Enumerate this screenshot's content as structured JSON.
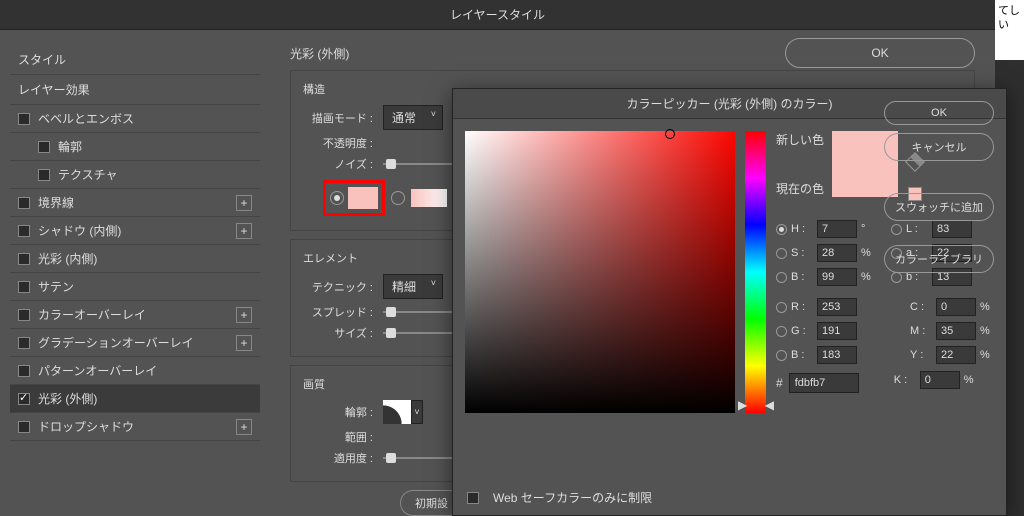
{
  "rightStrip": "てし\nい",
  "dialog": {
    "title": "レイヤースタイル",
    "okLabel": "OK",
    "sidebar": {
      "header1": "スタイル",
      "header2": "レイヤー効果",
      "items": [
        {
          "label": "ベベルとエンボス",
          "checked": false,
          "plus": false,
          "indent": false
        },
        {
          "label": "輪郭",
          "checked": false,
          "plus": false,
          "indent": true
        },
        {
          "label": "テクスチャ",
          "checked": false,
          "plus": false,
          "indent": true
        },
        {
          "label": "境界線",
          "checked": false,
          "plus": true,
          "indent": false
        },
        {
          "label": "シャドウ (内側)",
          "checked": false,
          "plus": true,
          "indent": false
        },
        {
          "label": "光彩 (内側)",
          "checked": false,
          "plus": false,
          "indent": false
        },
        {
          "label": "サテン",
          "checked": false,
          "plus": false,
          "indent": false
        },
        {
          "label": "カラーオーバーレイ",
          "checked": false,
          "plus": true,
          "indent": false
        },
        {
          "label": "グラデーションオーバーレイ",
          "checked": false,
          "plus": true,
          "indent": false
        },
        {
          "label": "パターンオーバーレイ",
          "checked": false,
          "plus": false,
          "indent": false
        },
        {
          "label": "光彩 (外側)",
          "checked": true,
          "plus": false,
          "indent": false,
          "active": true
        },
        {
          "label": "ドロップシャドウ",
          "checked": false,
          "plus": true,
          "indent": false
        }
      ]
    },
    "panel": {
      "title": "光彩 (外側)",
      "struct": {
        "title": "構造",
        "blendMode": {
          "label": "描画モード :",
          "value": "通常"
        },
        "opacity": {
          "label": "不透明度 :"
        },
        "noise": {
          "label": "ノイズ :"
        }
      },
      "element": {
        "title": "エレメント",
        "technique": {
          "label": "テクニック :",
          "value": "精細"
        },
        "spread": {
          "label": "スプレッド :"
        },
        "size": {
          "label": "サイズ :"
        }
      },
      "quality": {
        "title": "画質",
        "contour": {
          "label": "輪郭 :"
        },
        "range": {
          "label": "範囲 :"
        },
        "jitter": {
          "label": "適用度 :"
        }
      },
      "resetBtn": "初期設"
    }
  },
  "picker": {
    "title": "カラーピッカー (光彩 (外側) のカラー)",
    "newLabel": "新しい色",
    "currentLabel": "現在の色",
    "okLabel": "OK",
    "cancelLabel": "キャンセル",
    "addSwatchLabel": "スウォッチに追加",
    "libraryLabel": "カラーライブラリ",
    "webSafe": "Web セーフカラーのみに制限",
    "hsv": {
      "H": "7",
      "S": "28",
      "B": "99"
    },
    "lab": {
      "L": "83",
      "a": "22",
      "b": "13"
    },
    "rgb": {
      "R": "253",
      "G": "191",
      "B": "183"
    },
    "cmyk": {
      "C": "0",
      "M": "35",
      "Y": "22",
      "K": "0"
    },
    "hex": "fdbfb7",
    "hLabel": "H :",
    "sLabel": "S :",
    "bLabel": "B :",
    "lLabel": "L :",
    "aLabel": "a :",
    "b2Label": "b :",
    "rLabel": "R :",
    "gLabel": "G :",
    "b3Label": "B :",
    "cLabel": "C :",
    "mLabel": "M :",
    "yLabel": "Y :",
    "kLabel": "K :",
    "degUnit": "°",
    "pctUnit": "%",
    "hashLabel": "#"
  }
}
